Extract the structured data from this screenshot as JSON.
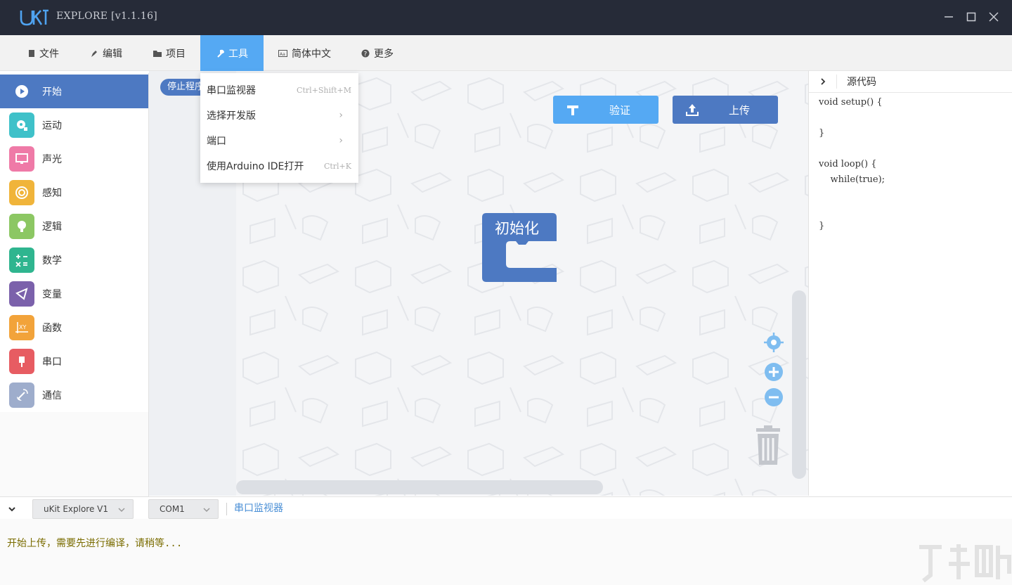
{
  "window": {
    "logo_text": "UKIT",
    "title": "EXPLORE [v1.1.16]"
  },
  "menu": {
    "items": [
      {
        "label": "文件",
        "icon": "file-icon"
      },
      {
        "label": "编辑",
        "icon": "pen-icon"
      },
      {
        "label": "项目",
        "icon": "folder-icon"
      },
      {
        "label": "工具",
        "icon": "wrench-icon"
      },
      {
        "label": "简体中文",
        "icon": "language-icon"
      },
      {
        "label": "更多",
        "icon": "help-icon"
      }
    ],
    "active": "工具"
  },
  "tools_dropdown": {
    "items": [
      {
        "label": "串口监视器",
        "shortcut": "Ctrl+Shift+M"
      },
      {
        "label": "选择开发版",
        "arrow": "›"
      },
      {
        "label": "端口",
        "arrow": "›"
      },
      {
        "label": "使用Arduino IDE打开",
        "shortcut": "Ctrl+K"
      }
    ]
  },
  "categories": [
    {
      "label": "开始",
      "color": "#4d79c2",
      "icon": "play-icon"
    },
    {
      "label": "运动",
      "color": "#3fc1c9",
      "icon": "motion-icon"
    },
    {
      "label": "声光",
      "color": "#ef7aa7",
      "icon": "display-icon"
    },
    {
      "label": "感知",
      "color": "#f0b43a",
      "icon": "sensor-icon"
    },
    {
      "label": "逻辑",
      "color": "#8cc763",
      "icon": "bulb-icon"
    },
    {
      "label": "数学",
      "color": "#2fb58f",
      "icon": "math-icon"
    },
    {
      "label": "变量",
      "color": "#7b61ab",
      "icon": "variable-icon"
    },
    {
      "label": "函数",
      "color": "#f2a33a",
      "icon": "function-icon"
    },
    {
      "label": "串口",
      "color": "#e75c62",
      "icon": "usb-icon"
    },
    {
      "label": "通信",
      "color": "#9eadcc",
      "icon": "satellite-icon"
    }
  ],
  "workspace": {
    "stop_block": "停止程序",
    "verify_label": "验证",
    "upload_label": "上传",
    "init_block": "初始化"
  },
  "code_panel": {
    "title": "源代码",
    "lines": [
      "void setup() {",
      "",
      "}",
      "",
      "void loop() {",
      "    while(true);",
      "",
      "",
      "}"
    ]
  },
  "bottom": {
    "board": "uKit Explore V1",
    "port": "COM1",
    "serial_monitor": "串口监视器"
  },
  "console": {
    "message": "开始上传，需要先进行编译，请稍等..."
  },
  "colors": {
    "titlebar": "#262b38",
    "accent": "#55a9f3",
    "primary": "#4d79c2"
  }
}
